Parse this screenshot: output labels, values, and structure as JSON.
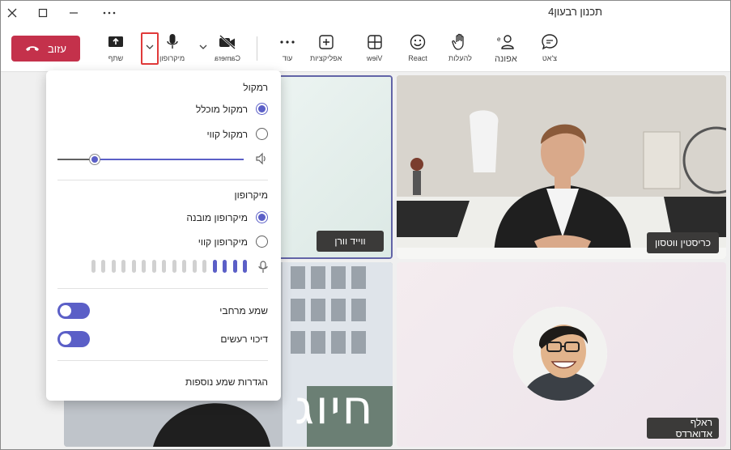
{
  "window": {
    "title": "תכנון רבעון4",
    "controls": {
      "more": "···",
      "minimize": "—",
      "maximize": "☐",
      "close": "✕"
    }
  },
  "toolbar": {
    "leave_label": "עזוב",
    "share_label": "שתף",
    "mic_label": "מיקרופון",
    "camera_label": "Camera",
    "more_label": "עוד",
    "apps_label": "אפליקציות",
    "view_label": "View",
    "react_label": "React",
    "raise_label": "להעלות",
    "people_label": "אפונה",
    "chat_label": "צ'אט"
  },
  "audio_panel": {
    "speaker_heading": "רמקול",
    "speaker_options": [
      {
        "label": "רמקול מוכלל",
        "selected": true
      },
      {
        "label": "רמקול קווי",
        "selected": false
      }
    ],
    "volume": 0.2,
    "mic_heading": "מיקרופון",
    "mic_options": [
      {
        "label": "מיקרופון מובנה",
        "selected": true
      },
      {
        "label": "מיקרופון קווי",
        "selected": false
      }
    ],
    "mic_level_active_bars": 4,
    "mic_level_total_bars": 16,
    "spatial_audio_label": "שמע מרחבי",
    "noise_suppression_label": "דיכוי רעשים",
    "more_settings_label": "הגדרות שמע נוספות"
  },
  "participants": [
    {
      "name": "ווייד וורן",
      "speaking": true
    },
    {
      "name": "כריסטין ווטסון",
      "speaking": false
    },
    {
      "name": "ראלף אדוארדס",
      "speaking": false
    }
  ],
  "shared_text": "חיוג",
  "colors": {
    "accent": "#5b5fc7",
    "leave": "#c4314b",
    "highlight": "#e03a3a"
  }
}
